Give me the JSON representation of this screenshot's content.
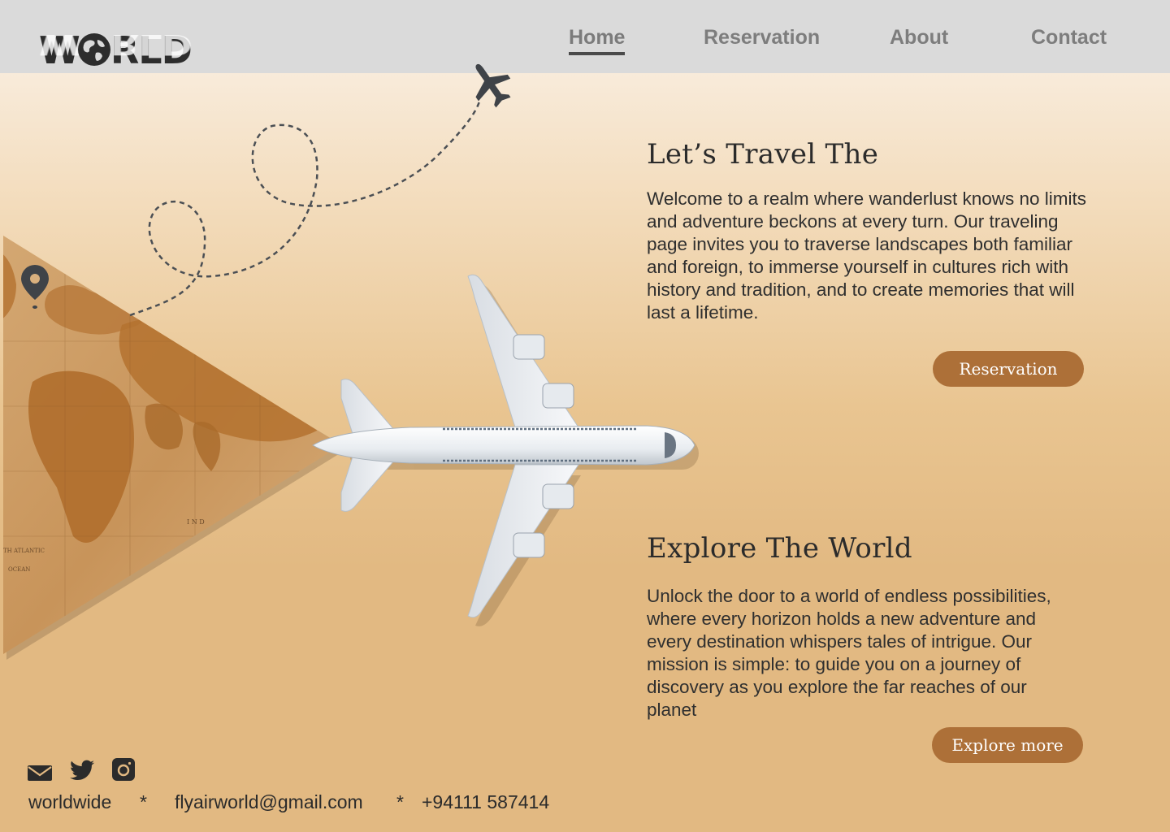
{
  "brand": {
    "logo_text": "WORLD"
  },
  "nav": {
    "home": "Home",
    "reservation": "Reservation",
    "about": "About",
    "contact": "Contact"
  },
  "hero": {
    "title": "Let’s  Travel  The",
    "body": "Welcome to a realm where wanderlust knows no limits and adventure beckons at every turn. Our traveling page invites you to traverse landscapes both familiar and foreign, to immerse yourself in cultures rich with history and tradition, and to create memories that will last a lifetime.",
    "button": "Reservation"
  },
  "explore": {
    "title": "Explore The World",
    "body": "Unlock the door to a world of endless possibilities, where every horizon holds a new adventure and every destination whispers tales of intrigue. Our mission is simple: to guide you on a journey of discovery as you explore the far reaches of our planet",
    "button": "Explore more"
  },
  "map": {
    "labels": [
      "I N D",
      "TH ATLANTIC",
      "OCEAN"
    ]
  },
  "footer": {
    "handle": "worldwide",
    "sep": "*",
    "email": "flyairworld@gmail.com",
    "phone": "+94111 587414",
    "icons": [
      "mail-icon",
      "twitter-icon",
      "instagram-icon"
    ]
  },
  "colors": {
    "accent": "#ad7038",
    "topbar": "#dadada",
    "background": "#e2b982"
  }
}
